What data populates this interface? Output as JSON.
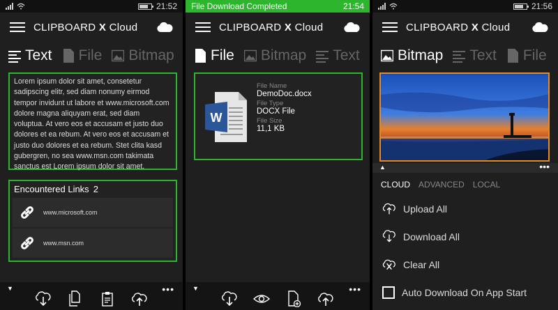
{
  "app": {
    "title_prefix": "CLIPBOARD",
    "title_x": "X",
    "title_suffix": "Cloud"
  },
  "colors": {
    "accent_green": "#2db52d",
    "accent_orange": "#e78a22",
    "background": "#1f1f1f"
  },
  "panel1": {
    "time": "21:52",
    "tabs": [
      "Text",
      "File",
      "Bitmap"
    ],
    "text_content": "Lorem ipsum dolor sit amet, consetetur sadipscing elitr, sed diam nonumy eirmod tempor invidunt ut labore et www.microsoft.com dolore magna aliquyam erat, sed diam voluptua. At vero eos et accusam et justo duo dolores et ea rebum. At vero eos et accusam et justo duo dolores et ea rebum. Stet clita kasd gubergren, no sea www.msn.com takimata sanctus est Lorem ipsum dolor sit amet.",
    "links_header": "Encountered Links",
    "links_count": "2",
    "links": [
      "www.microsoft.com",
      "www.msn.com"
    ]
  },
  "panel2": {
    "notification": "File Download Completed",
    "time": "21:54",
    "tabs": [
      "File",
      "Bitmap",
      "Text"
    ],
    "file": {
      "name_label": "File Name",
      "name": "DemoDoc.docx",
      "type_label": "File Type",
      "type": "DOCX File",
      "size_label": "File Size",
      "size": "11,1 KB"
    }
  },
  "panel3": {
    "time": "21:56",
    "tabs": [
      "Bitmap",
      "Text",
      "File"
    ],
    "pivots": [
      "CLOUD",
      "ADVANCED",
      "LOCAL"
    ],
    "actions": [
      "Upload All",
      "Download All",
      "Clear All"
    ],
    "auto_download": "Auto Download On App Start"
  }
}
